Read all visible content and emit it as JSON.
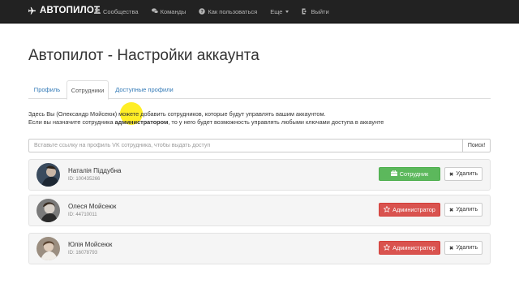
{
  "navbar": {
    "brand": "АВТОПИЛОТ",
    "items": [
      {
        "label": "Сообщества",
        "icon": "users-icon",
        "glyph": "👥"
      },
      {
        "label": "Команды",
        "icon": "chat-icon",
        "glyph": "🗨"
      },
      {
        "label": "Как пользоваться",
        "icon": "question-icon",
        "glyph": "❓"
      },
      {
        "label": "Еще",
        "icon": "",
        "glyph": ""
      },
      {
        "label": "Выйти",
        "icon": "exit-icon",
        "glyph": "⇥"
      }
    ]
  },
  "page": {
    "title": "Автопилот - Настройки аккаунта"
  },
  "tabs": [
    {
      "label": "Профиль",
      "active": false
    },
    {
      "label": "Сотрудники",
      "active": true
    },
    {
      "label": "Доступные профили",
      "active": false
    }
  ],
  "description": {
    "line1": "Здесь Вы (Олександр Мойсеюк) можете добавить сотрудников, которые будут управлять вашим аккаунтом.",
    "line2_prefix": "Если вы назначите сотрудника ",
    "line2_bold": "администратором",
    "line2_suffix": ", то у него будет возможность управлять любыми ключами доступа в аккаунте"
  },
  "search": {
    "placeholder": "Вставьте ссылку на профиль VK сотрудника, чтобы выдать доступ",
    "value": "",
    "button": "Поиск!"
  },
  "employees": [
    {
      "name": "Наталія Піддубна",
      "id": "ID: 100435266",
      "role": "Сотрудник",
      "role_color": "#5cb85c",
      "role_icon": "briefcase-icon",
      "delete_label": "Удалить"
    },
    {
      "name": "Олеся Мойсеюк",
      "id": "ID: 44710011",
      "role": "Администратор",
      "role_color": "#d9534f",
      "role_icon": "star-icon",
      "delete_label": "Удалить"
    },
    {
      "name": "Юлія Мойсеюк",
      "id": "ID: 16078793",
      "role": "Администратор",
      "role_color": "#d9534f",
      "role_icon": "star-icon",
      "delete_label": "Удалить"
    }
  ]
}
